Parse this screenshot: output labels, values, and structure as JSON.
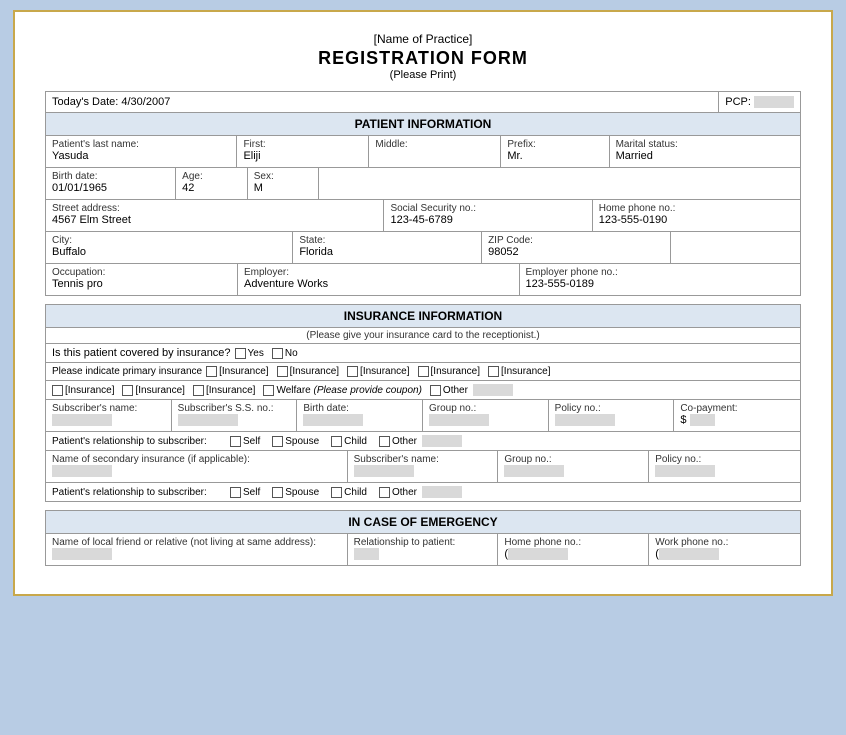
{
  "header": {
    "practice_name": "[Name of Practice]",
    "form_title": "REGISTRATION FORM",
    "please_print": "(Please Print)"
  },
  "top_info": {
    "date_label": "Today's Date:",
    "date_value": "4/30/2007",
    "pcp_label": "PCP:"
  },
  "patient_section": {
    "title": "PATIENT INFORMATION",
    "last_name_label": "Patient's last name:",
    "last_name_value": "Yasuda",
    "first_label": "First:",
    "first_value": "Eliji",
    "middle_label": "Middle:",
    "prefix_label": "Prefix:",
    "prefix_value": "Mr.",
    "marital_label": "Marital status:",
    "marital_value": "Married",
    "birth_label": "Birth date:",
    "birth_value": "01/01/1965",
    "age_label": "Age:",
    "age_value": "42",
    "sex_label": "Sex:",
    "sex_value": "M",
    "street_label": "Street address:",
    "street_value": "4567 Elm Street",
    "ssn_label": "Social Security no.:",
    "ssn_value": "123-45-6789",
    "home_phone_label": "Home phone no.:",
    "home_phone_value": "123-555-0190",
    "city_label": "City:",
    "city_value": "Buffalo",
    "state_label": "State:",
    "state_value": "Florida",
    "zip_label": "ZIP Code:",
    "zip_value": "98052",
    "occupation_label": "Occupation:",
    "occupation_value": "Tennis pro",
    "employer_label": "Employer:",
    "employer_value": "Adventure Works",
    "employer_phone_label": "Employer phone no.:",
    "employer_phone_value": "123-555-0189"
  },
  "insurance_section": {
    "title": "INSURANCE INFORMATION",
    "subtitle": "(Please give your insurance card to the receptionist.)",
    "covered_label": "Is this patient covered by insurance?",
    "yes_label": "Yes",
    "no_label": "No",
    "primary_label": "Please indicate primary insurance",
    "insurance_options": [
      "[Insurance]",
      "[Insurance]",
      "[Insurance]",
      "[Insurance]",
      "[Insurance]",
      "[Insurance]",
      "[Insurance]",
      "[Insurance]"
    ],
    "welfare_label": "Welfare",
    "welfare_note": "(Please provide coupon)",
    "other_label": "Other",
    "subscriber_name_label": "Subscriber's name:",
    "subscriber_ss_label": "Subscriber's S.S. no.:",
    "birth_date_label": "Birth date:",
    "group_no_label": "Group no.:",
    "policy_no_label": "Policy no.:",
    "copay_label": "Co-payment:",
    "copay_prefix": "$ ",
    "relationship_label": "Patient's relationship to subscriber:",
    "self_label": "Self",
    "spouse_label": "Spouse",
    "child_label": "Child",
    "other_rel_label": "Other",
    "secondary_ins_label": "Name of secondary insurance (if applicable):",
    "secondary_subscriber_label": "Subscriber's name:",
    "secondary_group_label": "Group no.:",
    "secondary_policy_label": "Policy no.:",
    "relationship2_label": "Patient's relationship to subscriber:",
    "self2_label": "Self",
    "spouse2_label": "Spouse",
    "child2_label": "Child",
    "other2_label": "Other"
  },
  "emergency_section": {
    "title": "IN CASE OF EMERGENCY",
    "friend_label": "Name of local friend or relative (not living at same address):",
    "relationship_label": "Relationship to patient:",
    "home_phone_label": "Home phone no.:",
    "home_phone_format": "(",
    "work_phone_label": "Work phone no.:",
    "work_phone_format": "("
  }
}
